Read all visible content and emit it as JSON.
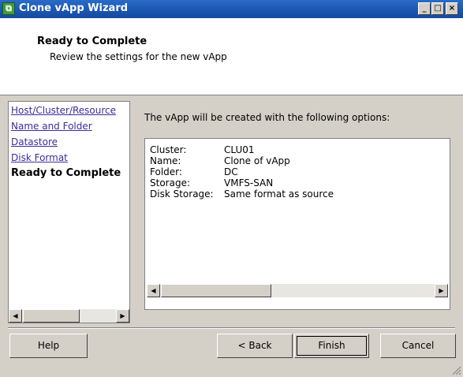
{
  "window": {
    "title": "Clone vApp Wizard",
    "minimize": "_",
    "maximize": "□",
    "close": "×"
  },
  "header": {
    "title": "Ready to Complete",
    "subtitle": "Review the settings for the new vApp"
  },
  "sidebar": {
    "items": [
      {
        "label": "Host/Cluster/Resource",
        "current": false
      },
      {
        "label": "Name and Folder",
        "current": false
      },
      {
        "label": "Datastore",
        "current": false
      },
      {
        "label": "Disk Format",
        "current": false
      },
      {
        "label": "Ready to Complete",
        "current": true
      }
    ]
  },
  "content": {
    "intro": "The vApp will be created with the following options:",
    "rows": [
      {
        "key": "Cluster:",
        "value": "CLU01"
      },
      {
        "key": "Name:",
        "value": "Clone of vApp"
      },
      {
        "key": "Folder:",
        "value": "DC"
      },
      {
        "key": "Storage:",
        "value": "VMFS-SAN"
      },
      {
        "key": "Disk Storage:",
        "value": "Same format as source"
      }
    ]
  },
  "buttons": {
    "help": "Help",
    "back": "< Back",
    "finish": "Finish",
    "cancel": "Cancel"
  },
  "colors": {
    "titlebar": "#1a56b0",
    "link": "#3b2d9b",
    "face": "#d4d0c8"
  }
}
